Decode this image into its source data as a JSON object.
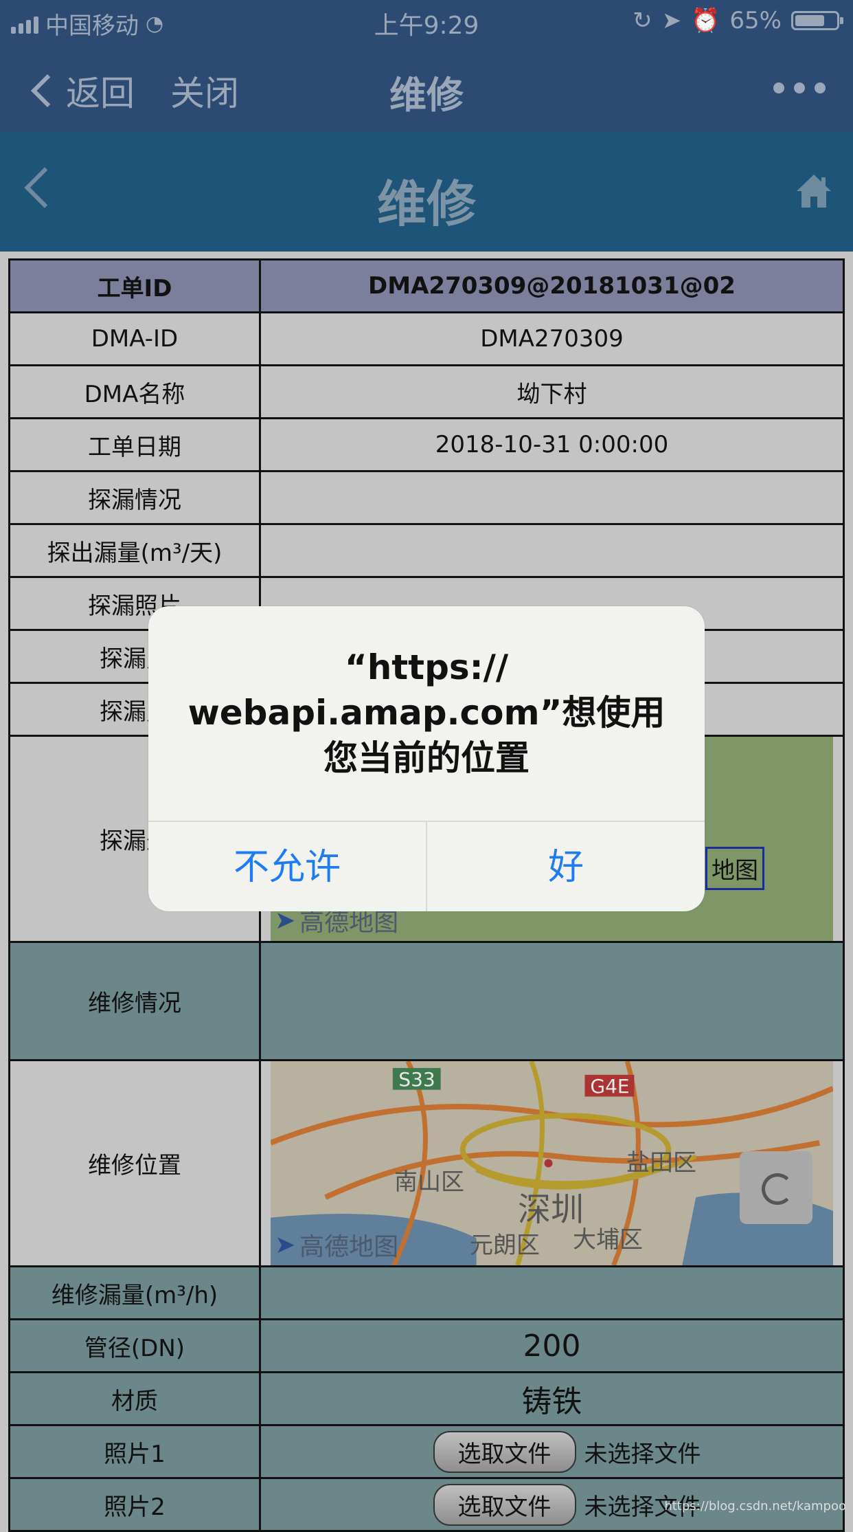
{
  "status": {
    "carrier": "中国移动",
    "time": "上午9:29",
    "battery": "65%",
    "battery_level": 0.65
  },
  "wxnav": {
    "back_label": "返回",
    "close_label": "关闭",
    "title": "维修"
  },
  "app": {
    "title": "维修"
  },
  "table": {
    "header": {
      "key": "工单ID",
      "value": "DMA270309@20181031@02"
    },
    "rows": [
      {
        "key": "DMA-ID",
        "value": "DMA270309"
      },
      {
        "key": "DMA名称",
        "value": "坳下村"
      },
      {
        "key": "工单日期",
        "value": "2018-10-31 0:00:00"
      },
      {
        "key": "探漏情况",
        "value": ""
      },
      {
        "key": "探出漏量(m³/天)",
        "value": ""
      },
      {
        "key": "探漏照片",
        "value": ""
      },
      {
        "key": "探漏照",
        "value": ""
      },
      {
        "key": "探漏照",
        "value": ""
      }
    ],
    "leak_position_key": "探漏坐",
    "map_button": "地图",
    "map_logo": "高德地图",
    "repair_status_key": "维修情况",
    "repair_position_key": "维修位置",
    "map2_labels": {
      "road1": "S33",
      "road2": "G4E",
      "district1": "南山区",
      "city": "深圳",
      "district2": "盐田区",
      "district3": "元朗区",
      "district4": "大埔区"
    },
    "repair_leak_key": "维修漏量(m³/h)",
    "pipe_key": "管径(DN)",
    "pipe_value": "200",
    "material_key": "材质",
    "material_value": "铸铁",
    "photo1_key": "照片1",
    "photo2_key": "照片2",
    "choose_file": "选取文件",
    "no_file": "未选择文件"
  },
  "dialog": {
    "message": "“https:// webapi.amap.com”想使用您当前的位置",
    "deny": "不允许",
    "allow": "好"
  },
  "watermark": "https://blog.csdn.net/kampoo"
}
